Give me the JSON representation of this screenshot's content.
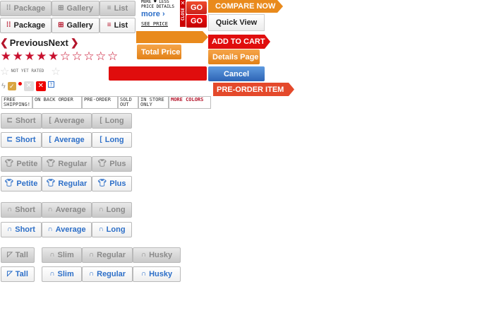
{
  "view_toggle": {
    "package": "Package",
    "gallery": "Gallery",
    "list": "List"
  },
  "pricing": {
    "more_less": "MORE ♥ LESS",
    "price_details": "PRICE DETAILS",
    "more": "more ›",
    "see_price": "SEE PRICE",
    "close": "CLOSE",
    "go_label": "GO"
  },
  "actions": {
    "compare_now": "COMPARE NOW",
    "quick_view": "Quick View",
    "add_to_cart": "ADD TO CART",
    "total_price": "Total Price",
    "details_page": "Details Page",
    "cancel": "Cancel",
    "pre_order_item": "PRE-ORDER ITEM"
  },
  "navigation": {
    "previous": "Previous",
    "next": "Next"
  },
  "rating": {
    "filled_stars": 5,
    "total_stars": 10,
    "not_yet_rated": "NOT YET RATED"
  },
  "tags": {
    "free_shipping": "FREE SHIPPING!",
    "on_back_order": "ON BACK ORDER",
    "pre_order": "PRE-ORDER",
    "sold_out": "SOLD OUT",
    "in_store_only": "IN STORE ONLY",
    "more_colors": "MORE COLORS"
  },
  "sizes": {
    "length": {
      "short": "Short",
      "average": "Average",
      "long": "Long"
    },
    "type": {
      "petite": "Petite",
      "regular": "Regular",
      "plus": "Plus"
    },
    "inseam": {
      "short": "Short",
      "average": "Average",
      "long": "Long"
    },
    "fit": {
      "tall": "Tall",
      "slim": "Slim",
      "regular": "Regular",
      "husky": "Husky"
    }
  },
  "colors": {
    "accent_orange": "#e98a1c",
    "accent_red": "#e00d0d",
    "accent_blue": "#2d6fc8",
    "star_red": "#c8102e"
  }
}
